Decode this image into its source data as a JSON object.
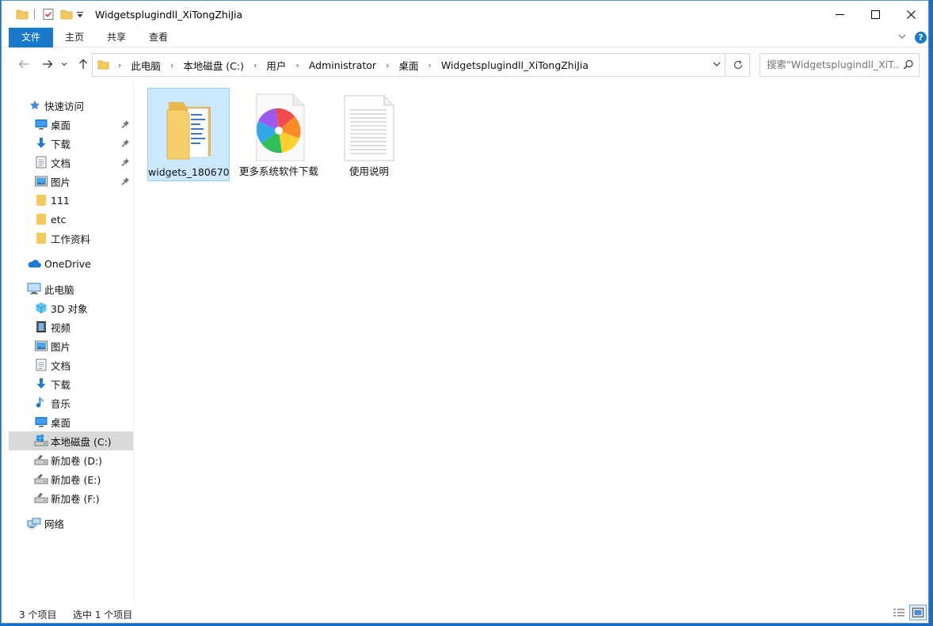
{
  "window": {
    "title": "Widgetsplugindll_XiTongZhiJia"
  },
  "ribbon": {
    "tabs": [
      {
        "label": "文件"
      },
      {
        "label": "主页"
      },
      {
        "label": "共享"
      },
      {
        "label": "查看"
      }
    ],
    "help_label": "?"
  },
  "address": {
    "crumbs": [
      "此电脑",
      "本地磁盘 (C:)",
      "用户",
      "Administrator",
      "桌面",
      "Widgetsplugindll_XiTongZhiJia"
    ]
  },
  "search": {
    "placeholder": "搜索\"Widgetsplugindll_XiT..."
  },
  "sidebar": {
    "quick_access": {
      "label": "快速访问",
      "items": [
        {
          "label": "桌面",
          "icon": "desktop-icon",
          "pinned": true
        },
        {
          "label": "下载",
          "icon": "download-icon",
          "pinned": true
        },
        {
          "label": "文档",
          "icon": "document-icon",
          "pinned": true
        },
        {
          "label": "图片",
          "icon": "picture-icon",
          "pinned": true
        },
        {
          "label": "111",
          "icon": "folder-icon",
          "pinned": false
        },
        {
          "label": "etc",
          "icon": "folder-icon",
          "pinned": false
        },
        {
          "label": "工作资料",
          "icon": "folder-icon",
          "pinned": false
        }
      ]
    },
    "onedrive": {
      "label": "OneDrive"
    },
    "this_pc": {
      "label": "此电脑",
      "items": [
        {
          "label": "3D 对象",
          "icon": "3d-objects-icon"
        },
        {
          "label": "视频",
          "icon": "video-icon"
        },
        {
          "label": "图片",
          "icon": "picture-icon"
        },
        {
          "label": "文档",
          "icon": "document-icon"
        },
        {
          "label": "下载",
          "icon": "download-icon"
        },
        {
          "label": "音乐",
          "icon": "music-icon"
        },
        {
          "label": "桌面",
          "icon": "desktop-icon"
        },
        {
          "label": "本地磁盘 (C:)",
          "icon": "system-drive-icon",
          "selected": true
        },
        {
          "label": "新加卷 (D:)",
          "icon": "drive-icon"
        },
        {
          "label": "新加卷 (E:)",
          "icon": "drive-icon"
        },
        {
          "label": "新加卷 (F:)",
          "icon": "drive-icon"
        }
      ]
    },
    "network": {
      "label": "网络"
    }
  },
  "content": {
    "items": [
      {
        "name": "widgets_180670",
        "type": "folder",
        "selected": true
      },
      {
        "name": "更多系统软件下载",
        "type": "shortcut"
      },
      {
        "name": "使用说明",
        "type": "text-file"
      }
    ]
  },
  "status": {
    "count": "3 个项目",
    "selected": "选中 1 个项目"
  },
  "colors": {
    "accent": "#1979ca",
    "selection_bg": "#cce8ff",
    "selection_border": "#99d1ff",
    "sidebar_selected": "#d9d9d9"
  }
}
